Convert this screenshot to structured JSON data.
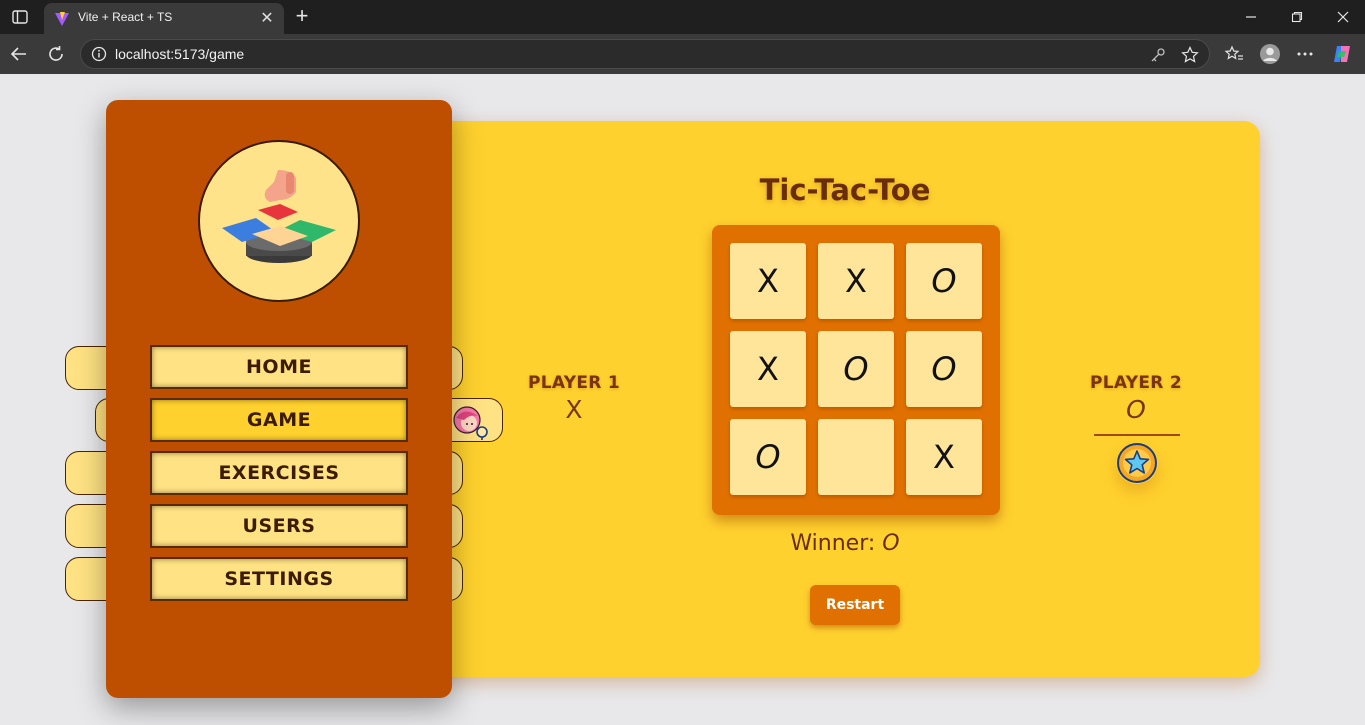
{
  "browser": {
    "tab_title": "Vite + React + TS",
    "tab_close": "✕",
    "new_tab": "+",
    "url": "localhost:5173/game"
  },
  "nav": {
    "items": [
      {
        "label": "HOME"
      },
      {
        "label": "GAME",
        "active": true
      },
      {
        "label": "EXERCISES"
      },
      {
        "label": "USERS"
      },
      {
        "label": "SETTINGS"
      }
    ]
  },
  "game": {
    "title": "Tic-Tac-Toe",
    "board": [
      "X",
      "X",
      "O",
      "X",
      "O",
      "O",
      "O",
      "",
      "X"
    ],
    "player1": {
      "label": "PLAYER 1",
      "mark": "X"
    },
    "player2": {
      "label": "PLAYER 2",
      "mark": "O"
    },
    "winner_label": "Winner:",
    "winner_value": "O",
    "restart_label": "Restart"
  },
  "colors": {
    "sidebar": "#bf4f00",
    "card": "#ffd12e",
    "board": "#e07000",
    "cell": "#ffe59a",
    "nav_button": "#ffe283"
  },
  "icons": {
    "logo": "puzzle-hand-icon",
    "winner_badge": "star-icon",
    "avatar": "avatar-icon"
  }
}
